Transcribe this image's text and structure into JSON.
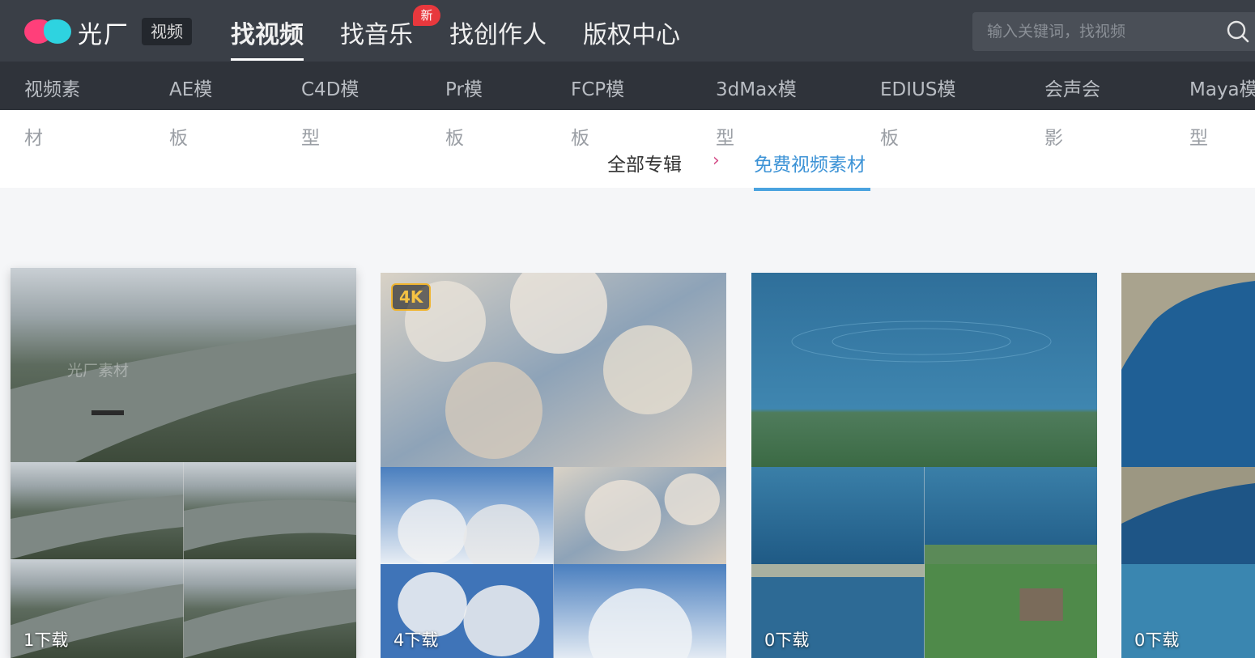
{
  "header": {
    "brand": "光厂",
    "brand_tag": "视频",
    "nav": [
      {
        "label": "找视频",
        "active": true
      },
      {
        "label": "找音乐",
        "badge": "新"
      },
      {
        "label": "找创作人"
      },
      {
        "label": "版权中心"
      }
    ],
    "search_placeholder": "输入关键词，找视频"
  },
  "categories": [
    {
      "line1": "视频素",
      "line2": "材"
    },
    {
      "line1": "AE模",
      "line2": "板"
    },
    {
      "line1": "C4D模",
      "line2": "型"
    },
    {
      "line1": "Pr模",
      "line2": "板"
    },
    {
      "line1": "FCP模",
      "line2": "板"
    },
    {
      "line1": "3dMax模",
      "line2": "型"
    },
    {
      "line1": "EDIUS模",
      "line2": "板"
    },
    {
      "line1": "会声会",
      "line2": "影"
    },
    {
      "line1": "Maya模",
      "line2": "型"
    }
  ],
  "breadcrumb": {
    "all": "全部专辑",
    "separator": "›",
    "current": "免费视频素材"
  },
  "cards": [
    {
      "downloads": "1下载",
      "watermark": "光厂素材"
    },
    {
      "downloads": "4下载",
      "badge": "4K"
    },
    {
      "downloads": "0下载"
    },
    {
      "downloads": "0下载"
    }
  ],
  "colors": {
    "header_bg": "#3a3f47",
    "category_bg": "#2f333a",
    "accent_blue": "#4aa3df",
    "badge_red": "#e8383d",
    "badge_4k": "#f0b531"
  }
}
